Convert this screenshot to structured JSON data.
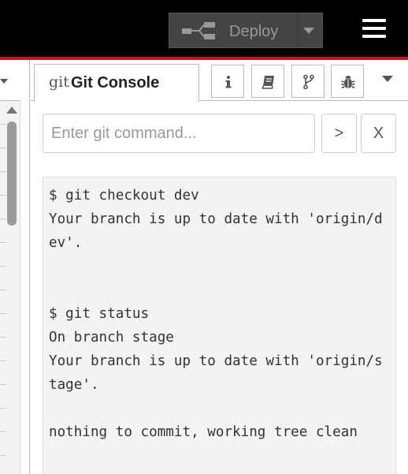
{
  "header": {
    "deploy_label": "Deploy",
    "deploy_icon": "deploy-flow-icon",
    "menu_icon": "hamburger-menu-icon",
    "background": "#000000",
    "accent_line": "#c8102e"
  },
  "sidebar": {
    "active_tab": {
      "icon_text": "git",
      "label": "Git Console"
    },
    "tab_buttons": [
      {
        "icon": "info-icon"
      },
      {
        "icon": "book-icon"
      },
      {
        "icon": "git-branch-icon"
      },
      {
        "icon": "bug-icon"
      }
    ],
    "more_icon": "chevron-down-icon"
  },
  "command": {
    "placeholder": "Enter git command...",
    "value": "",
    "run_label": ">",
    "clear_label": "X"
  },
  "output": {
    "blocks": [
      "$ git checkout dev\nYour branch is up to date with 'origin/dev'.",
      "$ git status\nOn branch stage\nYour branch is up to date with 'origin/stage'.",
      "nothing to commit, working tree clean"
    ]
  }
}
